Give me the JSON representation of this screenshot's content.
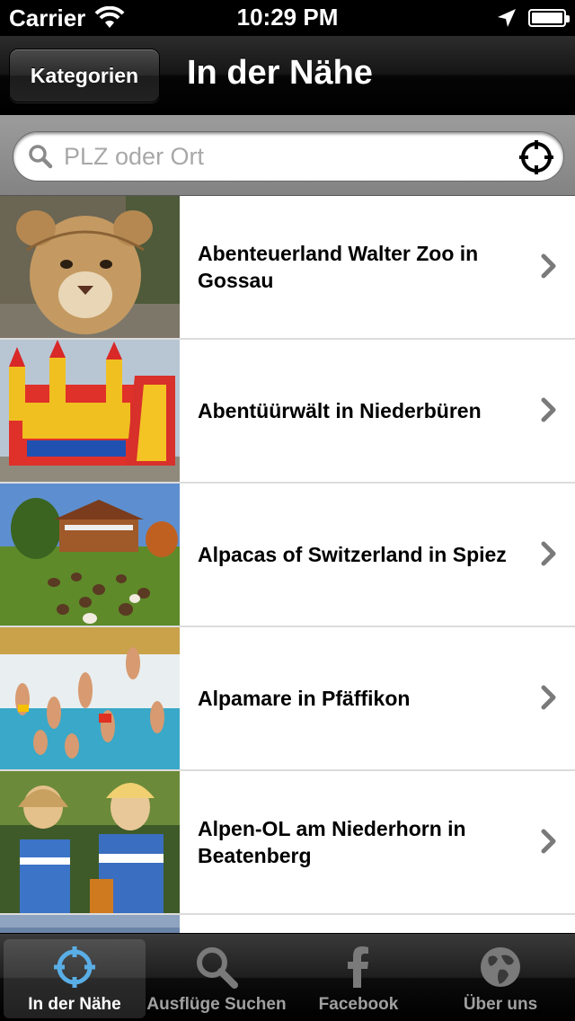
{
  "status_bar": {
    "carrier": "Carrier",
    "time": "10:29 PM"
  },
  "nav_bar": {
    "back_label": "Kategorien",
    "title": "In der Nähe"
  },
  "search": {
    "placeholder": "PLZ oder Ort",
    "value": ""
  },
  "list": {
    "items": [
      {
        "label": "Abenteuerland Walter Zoo in Gossau"
      },
      {
        "label": "Abentüürwält in Niederbüren"
      },
      {
        "label": "Alpacas of Switzerland in Spiez"
      },
      {
        "label": "Alpamare in Pfäffikon"
      },
      {
        "label": "Alpen-OL am Niederhorn in Beatenberg"
      }
    ]
  },
  "tab_bar": {
    "tabs": [
      {
        "label": "In der Nähe",
        "icon": "crosshair-icon",
        "active": true
      },
      {
        "label": "Ausflüge Suchen",
        "icon": "search-icon",
        "active": false
      },
      {
        "label": "Facebook",
        "icon": "facebook-icon",
        "active": false
      },
      {
        "label": "Über uns",
        "icon": "globe-icon",
        "active": false
      }
    ]
  },
  "colors": {
    "nav_bar": "#111111",
    "search_bar": "#8e8e8e",
    "tab_active": "#ffffff",
    "tab_inactive": "#a0a0a0",
    "accent_tab_icon": "#5aaee6"
  }
}
